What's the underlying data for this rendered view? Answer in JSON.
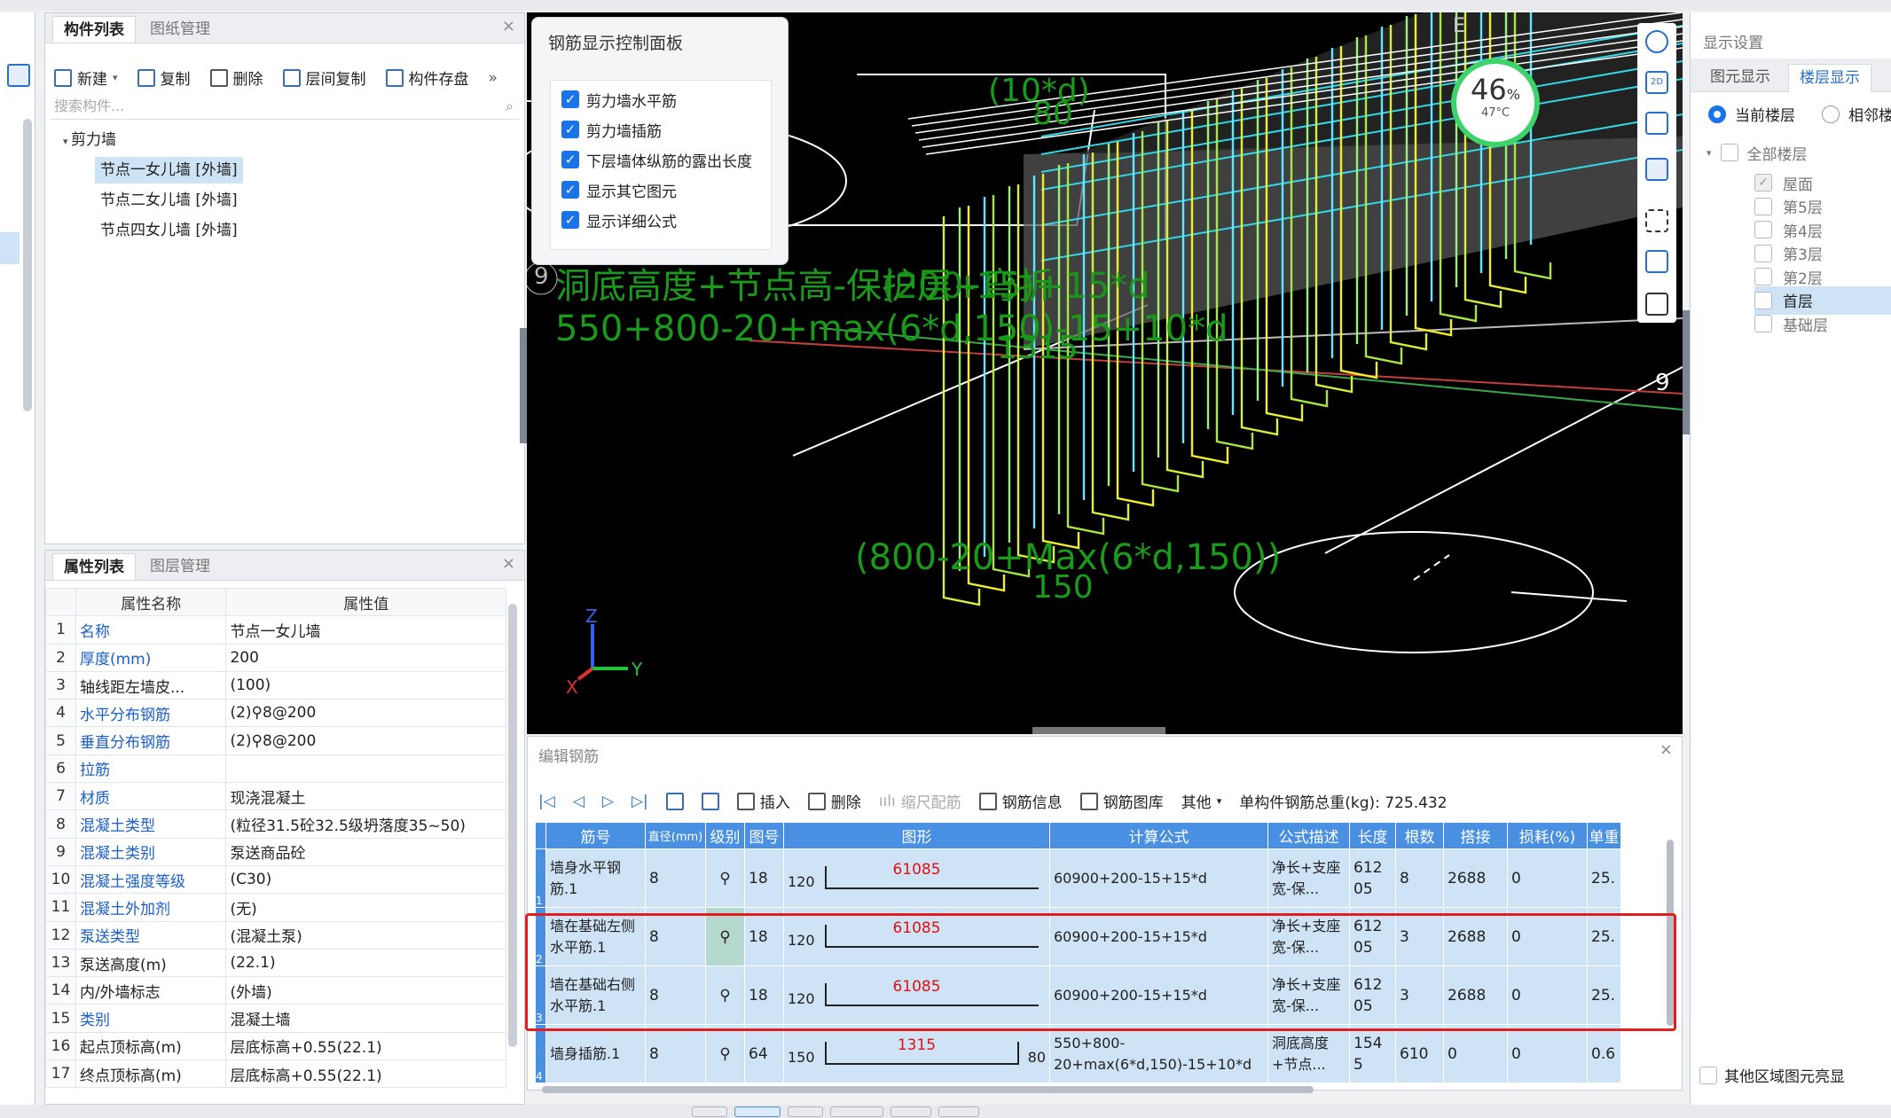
{
  "component_panel": {
    "tabs": [
      "构件列表",
      "图纸管理"
    ],
    "toolbar": {
      "new": "新建",
      "copy": "复制",
      "delete": "删除",
      "floor_copy": "层间复制",
      "save": "构件存盘"
    },
    "search_placeholder": "搜索构件...",
    "tree_root": "剪力墙",
    "items": [
      "节点一女儿墙 [外墙]",
      "节点二女儿墙 [外墙]",
      "节点四女儿墙 [外墙]"
    ]
  },
  "property_panel": {
    "tabs": [
      "属性列表",
      "图层管理"
    ],
    "headers": [
      "属性名称",
      "属性值"
    ],
    "rows": [
      {
        "n": "1",
        "name": "名称",
        "value": "节点一女儿墙",
        "link": true
      },
      {
        "n": "2",
        "name": "厚度(mm)",
        "value": "200",
        "link": true
      },
      {
        "n": "3",
        "name": "轴线距左墙皮...",
        "value": "(100)",
        "link": false
      },
      {
        "n": "4",
        "name": "水平分布钢筋",
        "value": "(2)⚲8@200",
        "link": true
      },
      {
        "n": "5",
        "name": "垂直分布钢筋",
        "value": "(2)⚲8@200",
        "link": true
      },
      {
        "n": "6",
        "name": "拉筋",
        "value": "",
        "link": true
      },
      {
        "n": "7",
        "name": "材质",
        "value": "现浇混凝土",
        "link": true
      },
      {
        "n": "8",
        "name": "混凝土类型",
        "value": "(粒径31.5砼32.5级坍落度35~50)",
        "link": true
      },
      {
        "n": "9",
        "name": "混凝土类别",
        "value": "泵送商品砼",
        "link": true
      },
      {
        "n": "10",
        "name": "混凝土强度等级",
        "value": "(C30)",
        "link": true
      },
      {
        "n": "11",
        "name": "混凝土外加剂",
        "value": "(无)",
        "link": true
      },
      {
        "n": "12",
        "name": "泵送类型",
        "value": "(混凝土泵)",
        "link": true
      },
      {
        "n": "13",
        "name": "泵送高度(m)",
        "value": "(22.1)",
        "link": false
      },
      {
        "n": "14",
        "name": "内/外墙标志",
        "value": "(外墙)",
        "link": false
      },
      {
        "n": "15",
        "name": "类别",
        "value": "混凝土墙",
        "link": true
      },
      {
        "n": "16",
        "name": "起点顶标高(m)",
        "value": "层底标高+0.55(22.1)",
        "link": false
      },
      {
        "n": "17",
        "name": "终点顶标高(m)",
        "value": "层底标高+0.55(22.1)",
        "link": false
      }
    ]
  },
  "control_panel": {
    "title": "钢筋显示控制面板",
    "options": [
      "剪力墙水平筋",
      "剪力墙插筋",
      "下层墙体纵筋的露出长度",
      "显示其它图元",
      "显示详细公式"
    ]
  },
  "viewport": {
    "labels": {
      "l1": "(10*d)",
      "l2": "80",
      "l3": "洞底高度+节点高-保护层+弯折",
      "l4": "(200-15)+15*d",
      "l5": "550+800-20+max(6*d,150)-15+10*d",
      "l6": "1315",
      "l7": "(800-20+Max(6*d,150))",
      "l8": "150",
      "axis_left": "9",
      "axis_right": "9",
      "axis_e": "E"
    },
    "gauge": {
      "value": "46",
      "unit": "%",
      "temp": "47°C",
      "level": 0.46
    },
    "axes": {
      "z": "Z",
      "y": "Y",
      "x": "X"
    }
  },
  "rebar_editor": {
    "title": "编辑钢筋",
    "toolbar": {
      "insert": "插入",
      "delete": "删除",
      "scale": "缩尺配筋",
      "info": "钢筋信息",
      "library": "钢筋图库",
      "other": "其他",
      "total": "单构件钢筋总重(kg): 725.432"
    },
    "headers": [
      "筋号",
      "直径(mm)",
      "级别",
      "图号",
      "图形",
      "计算公式",
      "公式描述",
      "长度",
      "根数",
      "搭接",
      "损耗(%)",
      "单重"
    ],
    "rows": [
      {
        "idx": "1",
        "name": "墙身水平钢筋.1",
        "dia": "8",
        "grade": "⚲",
        "fig": "18",
        "left": "120",
        "shape": "61085",
        "right": "",
        "formula": "60900+200-15+15*d",
        "desc": "净长+支座宽-保...",
        "len": "61205",
        "count": "8",
        "lap": "2688",
        "loss": "0",
        "unit": "25."
      },
      {
        "idx": "2",
        "name": "墙在基础左侧水平筋.1",
        "dia": "8",
        "grade": "⚲",
        "fig": "18",
        "left": "120",
        "shape": "61085",
        "right": "",
        "formula": "60900+200-15+15*d",
        "desc": "净长+支座宽-保...",
        "len": "61205",
        "count": "3",
        "lap": "2688",
        "loss": "0",
        "unit": "25."
      },
      {
        "idx": "3",
        "name": "墙在基础右侧水平筋.1",
        "dia": "8",
        "grade": "⚲",
        "fig": "18",
        "left": "120",
        "shape": "61085",
        "right": "",
        "formula": "60900+200-15+15*d",
        "desc": "净长+支座宽-保...",
        "len": "61205",
        "count": "3",
        "lap": "2688",
        "loss": "0",
        "unit": "25."
      },
      {
        "idx": "4",
        "name": "墙身插筋.1",
        "dia": "8",
        "grade": "⚲",
        "fig": "64",
        "left": "150",
        "shape": "1315",
        "right": "80",
        "formula": "550+800-20+max(6*d,150)-15+10*d",
        "desc": "洞底高度+节点...",
        "len": "1545",
        "count": "610",
        "lap": "0",
        "loss": "0",
        "unit": "0.6"
      }
    ]
  },
  "display_panel": {
    "title": "显示设置",
    "tabs": [
      "图元显示",
      "楼层显示"
    ],
    "radio_current": "当前楼层",
    "radio_adjacent": "相邻楼",
    "all_floors": "全部楼层",
    "floors": [
      "屋面",
      "第5层",
      "第4层",
      "第3层",
      "第2层",
      "首层",
      "基础层"
    ],
    "other_highlight": "其他区域图元亮显"
  },
  "colors": {
    "accent": "#4a90e2",
    "selected": "#cfe3f7",
    "red_box": "#e02020",
    "viewport_bg": "#000000",
    "green_label": "#1a9a1a"
  }
}
